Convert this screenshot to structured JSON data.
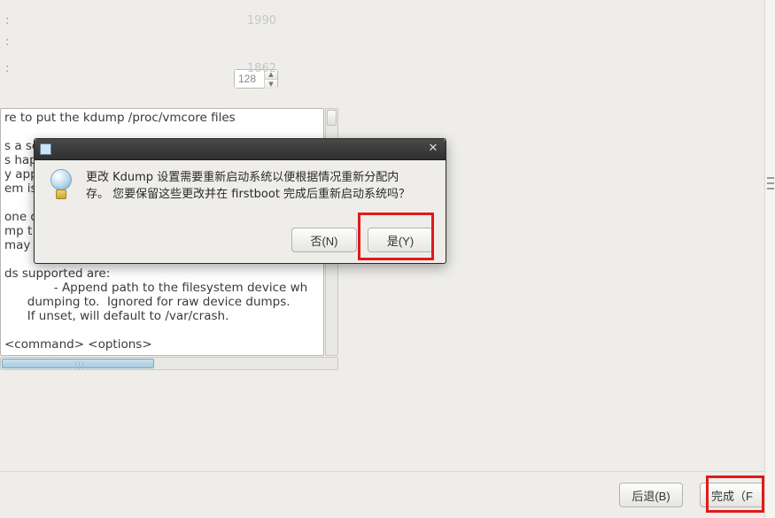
{
  "info": {
    "row1_colon": ":",
    "row1_value": "1990",
    "row2_colon": ":",
    "row2_spin_value": "128",
    "row3_colon": ":",
    "row3_value": "1862"
  },
  "textarea_text": "re to put the kdump /proc/vmcore files\n\ns a se\ns happ\ny applic\nem is\n\none du\nmp t\nmay b\n\nds supported are:\n             - Append path to the filesystem device wh\n      dumping to.  Ignored for raw device dumps.\n      If unset, will default to /var/crash.\n\n<command> <options>",
  "dialog": {
    "message_line1": "更改 Kdump 设置需要重新启动系统以便根据情况重新分配内",
    "message_line2": "存。 您要保留这些更改并在 firstboot 完成后重新启动系统吗？",
    "no_label": "否(N)",
    "yes_label": "是(Y)",
    "close_glyph": "✕"
  },
  "footer": {
    "back_label": "后退(B)",
    "finish_label": "完成（F"
  },
  "icons": {
    "spin_up": "▲",
    "spin_down": "▼"
  }
}
